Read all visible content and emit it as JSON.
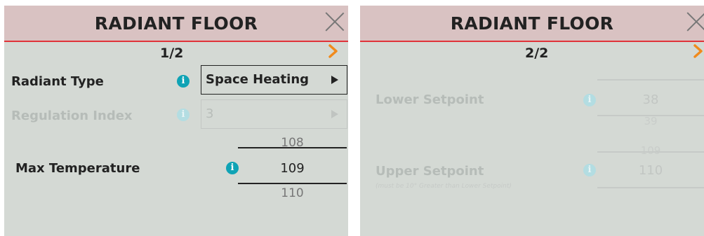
{
  "page1": {
    "title": "RADIANT FLOOR",
    "page_indicator": "1/2",
    "radiant_type": {
      "label": "Radiant Type",
      "value": "Space Heating"
    },
    "regulation_index": {
      "label": "Regulation Index",
      "value": "3"
    },
    "max_temperature": {
      "label": "Max Temperature",
      "prev": "108",
      "current": "109",
      "next": "110"
    }
  },
  "page2": {
    "title": "RADIANT FLOOR",
    "page_indicator": "2/2",
    "lower_setpoint": {
      "label": "Lower Setpoint",
      "current": "38",
      "next": "39"
    },
    "upper_setpoint": {
      "label": "Upper Setpoint",
      "note": "(must be 10° Greater than Lower Setpoint)",
      "prev": "109",
      "current": "110"
    }
  },
  "icons": {
    "close": "close-icon",
    "next": "chevron-right-icon",
    "info": "info-icon"
  },
  "colors": {
    "header": "#d9c2c2",
    "header_border": "#e0343a",
    "panel": "#d4d9d4",
    "info": "#0fa3b5",
    "chevron": "#f08a1c"
  }
}
